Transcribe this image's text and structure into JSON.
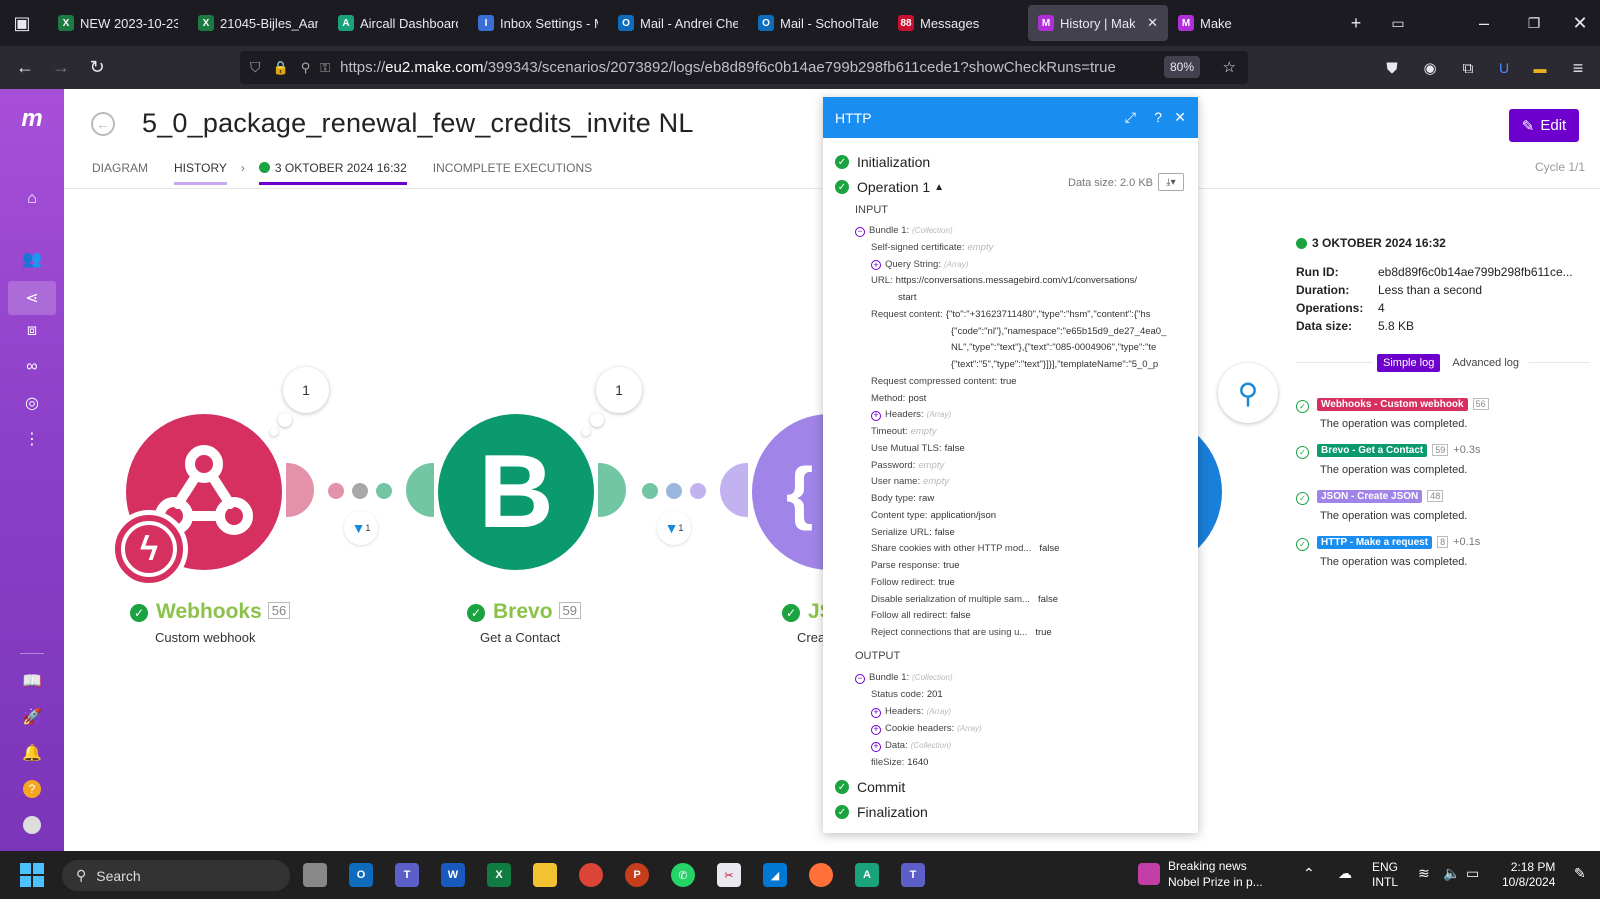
{
  "browser": {
    "tabs": [
      {
        "label": "NEW 2023-10-23_",
        "icon": "excel-icon",
        "color": "#1d7a43",
        "glyph": "X"
      },
      {
        "label": "21045-Bijles_Aan_",
        "icon": "excel-icon",
        "color": "#1d7a43",
        "glyph": "X"
      },
      {
        "label": "Aircall Dashboard",
        "icon": "aircall-icon",
        "color": "#1aa37a",
        "glyph": "A"
      },
      {
        "label": "Inbox Settings - M",
        "icon": "inbox-icon",
        "color": "#3b6fd8",
        "glyph": "I"
      },
      {
        "label": "Mail - Andrei Che",
        "icon": "outlook-icon",
        "color": "#0f6cbd",
        "glyph": "O"
      },
      {
        "label": "Mail - SchoolTale",
        "icon": "outlook-icon",
        "color": "#0f6cbd",
        "glyph": "O"
      },
      {
        "label": "Messages",
        "icon": "messages-icon",
        "color": "#c8102e",
        "glyph": "88"
      },
      {
        "label": "History | Make",
        "icon": "make-icon",
        "color": "#b02fd9",
        "glyph": "M"
      },
      {
        "label": "Make",
        "icon": "make-icon",
        "color": "#b02fd9",
        "glyph": "M"
      }
    ],
    "url_host": "eu2.make.com",
    "url_prefix": "https://",
    "url_path": "/399343/scenarios/2073892/logs/eb8d89f6c0b14ae799b298fb611cede1?showCheckRuns=true",
    "zoom": "80%"
  },
  "header": {
    "title": "5_0_package_renewal_few_credits_invite NL",
    "edit_label": "Edit",
    "cycle": "Cycle 1/1",
    "tabs": {
      "diagram": "DIAGRAM",
      "history": "HISTORY",
      "date": "3 OKTOBER 2024 16:32",
      "incomplete": "INCOMPLETE EXECUTIONS"
    }
  },
  "canvas": {
    "modules": [
      {
        "name": "Webhooks",
        "sub": "Custom webhook",
        "num": "56",
        "count": "1",
        "color": "#d5305f"
      },
      {
        "name": "Brevo",
        "sub": "Get a Contact",
        "num": "59",
        "count": "1",
        "color": "#0b996e"
      },
      {
        "name": "JS",
        "sub": "Creat",
        "color": "#a084e8"
      }
    ],
    "filters": [
      "1",
      "1"
    ]
  },
  "http_panel": {
    "title": "HTTP",
    "initialization": "Initialization",
    "operation": "Operation 1",
    "data_size": "Data size: 2.0 KB",
    "input": "INPUT",
    "output": "OUTPUT",
    "commit": "Commit",
    "finalization": "Finalization",
    "input_rows": [
      {
        "k": "Bundle 1:",
        "type": "(Collection)",
        "pm": "−",
        "indent": 0
      },
      {
        "k": "Self-signed certificate:",
        "empty": "empty",
        "indent": 1
      },
      {
        "k": "Query String:",
        "type": "(Array)",
        "pm": "+",
        "indent": 1
      },
      {
        "k": "URL:",
        "v": "https://conversations.messagebird.com/v1/conversations/",
        "indent": 1
      },
      {
        "k": "",
        "v": "start",
        "indent": 2
      },
      {
        "k": "Request content:",
        "v": "{\"to\":\"+31623711480\",\"type\":\"hsm\",\"content\":{\"hs",
        "indent": 1
      },
      {
        "k": "",
        "v": "{\"code\":\"nl\"},\"namespace\":\"e65b15d9_de27_4ea0_",
        "indent": 3
      },
      {
        "k": "",
        "v": "NL\",\"type\":\"text\"},{\"text\":\"085-0004906\",\"type\":\"te",
        "indent": 3
      },
      {
        "k": "",
        "v": "{\"text\":\"5\",\"type\":\"text\"}]}],\"templateName\":\"5_0_p",
        "indent": 3
      },
      {
        "k": "Request compressed content:",
        "v": "true",
        "indent": 1
      },
      {
        "k": "Method:",
        "v": "post",
        "indent": 1
      },
      {
        "k": "Headers:",
        "type": "(Array)",
        "pm": "+",
        "indent": 1
      },
      {
        "k": "Timeout:",
        "empty": "empty",
        "indent": 1
      },
      {
        "k": "Use Mutual TLS:",
        "v": "false",
        "indent": 1
      },
      {
        "k": "Password:",
        "empty": "empty",
        "indent": 1
      },
      {
        "k": "User name:",
        "empty": "empty",
        "indent": 1
      },
      {
        "k": "Body type:",
        "v": "raw",
        "indent": 1
      },
      {
        "k": "Content type:",
        "v": "application/json",
        "indent": 1
      },
      {
        "k": "Serialize URL:",
        "v": "false",
        "indent": 1
      },
      {
        "k": "Share cookies with other HTTP mod...",
        "v": "false",
        "indent": 1
      },
      {
        "k": "Parse response:",
        "v": "true",
        "indent": 1
      },
      {
        "k": "Follow redirect:",
        "v": "true",
        "indent": 1
      },
      {
        "k": "Disable serialization of multiple sam...",
        "v": "false",
        "indent": 1
      },
      {
        "k": "Follow all redirect:",
        "v": "false",
        "indent": 1
      },
      {
        "k": "Reject connections that are using u...",
        "v": "true",
        "indent": 1
      }
    ],
    "output_rows": [
      {
        "k": "Bundle 1:",
        "type": "(Collection)",
        "pm": "−",
        "indent": 0
      },
      {
        "k": "Status code:",
        "v": "201",
        "indent": 1
      },
      {
        "k": "Headers:",
        "type": "(Array)",
        "pm": "+",
        "indent": 1
      },
      {
        "k": "Cookie headers:",
        "type": "(Array)",
        "pm": "+",
        "indent": 1
      },
      {
        "k": "Data:",
        "type": "(Collection)",
        "pm": "+",
        "indent": 1
      },
      {
        "k": "fileSize:",
        "v": "1640",
        "indent": 1
      }
    ]
  },
  "log": {
    "date": "3 OKTOBER 2024 16:32",
    "run_id_label": "Run ID:",
    "run_id": "eb8d89f6c0b14ae799b298fb611ce...",
    "duration_label": "Duration:",
    "duration": "Less than a second",
    "operations_label": "Operations:",
    "operations": "4",
    "data_size_label": "Data size:",
    "data_size": "5.8 KB",
    "tab_simple": "Simple log",
    "tab_advanced": "Advanced log",
    "entries": [
      {
        "tag": "Webhooks - Custom webhook",
        "color": "#d5305f",
        "n": "56",
        "t": "",
        "msg": "The operation was completed."
      },
      {
        "tag": "Brevo - Get a Contact",
        "color": "#0b996e",
        "n": "59",
        "t": "+0.3s",
        "msg": "The operation was completed."
      },
      {
        "tag": "JSON - Create JSON",
        "color": "#a084e8",
        "n": "48",
        "t": "",
        "msg": "The operation was completed."
      },
      {
        "tag": "HTTP - Make a request",
        "color": "#1a8ef0",
        "n": "8",
        "t": "+0.1s",
        "msg": "The operation was completed."
      }
    ]
  },
  "taskbar": {
    "search": "Search",
    "news_title": "Breaking news",
    "news_sub": "Nobel Prize in p...",
    "lang1": "ENG",
    "lang2": "INTL",
    "time": "2:18 PM",
    "date": "10/8/2024"
  }
}
